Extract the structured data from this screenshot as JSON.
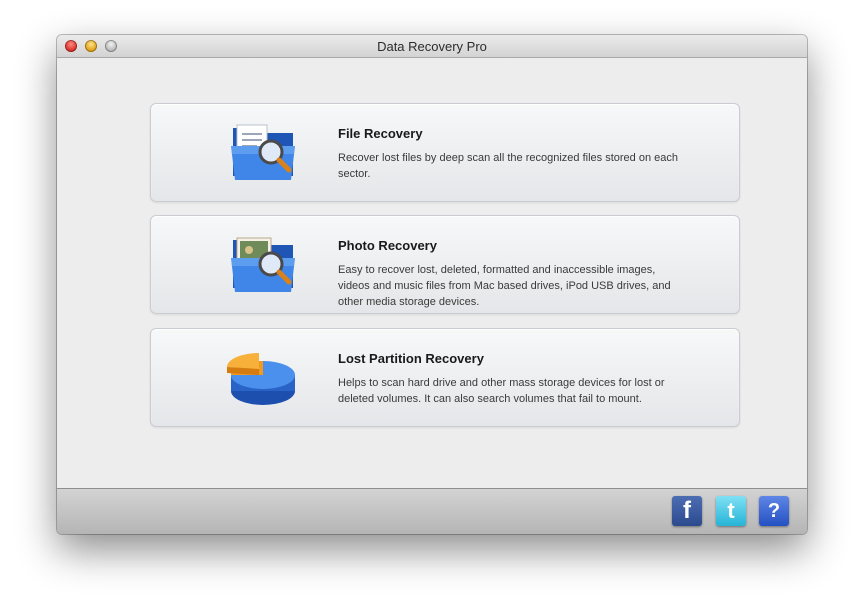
{
  "window": {
    "title": "Data Recovery Pro"
  },
  "options": [
    {
      "title": "File Recovery",
      "description": "Recover lost files by deep scan all the recognized files stored on each sector.",
      "icon": "folder-magnifier-icon"
    },
    {
      "title": "Photo Recovery",
      "description": "Easy to recover lost, deleted, formatted and inaccessible images, videos and music files from Mac based drives, iPod USB drives, and other media storage devices.",
      "icon": "photo-folder-magnifier-icon"
    },
    {
      "title": "Lost Partition Recovery",
      "description": "Helps to scan hard drive and other mass storage devices for lost or deleted volumes. It can also search volumes that fail to mount.",
      "icon": "pie-chart-disk-icon"
    }
  ],
  "footer": {
    "facebook_glyph": "f",
    "twitter_glyph": "t",
    "help_glyph": "?"
  },
  "colors": {
    "folder_blue": "#2f6fd1",
    "pie_blue": "#3a7be0",
    "pie_orange": "#f39a1e"
  }
}
